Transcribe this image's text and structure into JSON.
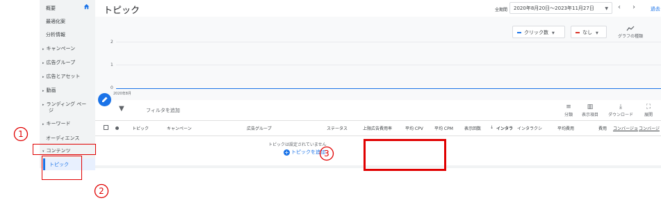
{
  "sidebar": {
    "items": [
      {
        "label": "概要",
        "expandable": false
      },
      {
        "label": "最適化案",
        "expandable": false
      },
      {
        "label": "分析情報",
        "expandable": false
      },
      {
        "label": "キャンペーン",
        "expandable": true
      },
      {
        "label": "広告グループ",
        "expandable": true
      },
      {
        "label": "広告とアセット",
        "expandable": true
      },
      {
        "label": "動画",
        "expandable": true
      },
      {
        "label": "ランディング ペー",
        "label2": "ジ",
        "expandable": true
      },
      {
        "label": "キーワード",
        "expandable": true
      },
      {
        "label": "オーディエンス",
        "expandable": false
      },
      {
        "label": "コンテンツ",
        "expandable": true,
        "expanded": true
      },
      {
        "label": "トピック",
        "active": true
      }
    ]
  },
  "header": {
    "title": "トピック",
    "period_label": "全期間",
    "date_range": "2020年8月20日～2023年11月27日",
    "nav_link": "過去"
  },
  "chart_controls": {
    "metric1": "クリック数",
    "metric1_color": "#1a73e8",
    "metric2": "なし",
    "metric2_color": "#d93025",
    "graph_type": "グラフの種類"
  },
  "chart_data": {
    "type": "line",
    "x": [
      "2020年8月"
    ],
    "series": [
      {
        "values": [
          0
        ]
      }
    ],
    "yticks": [
      "2",
      "1",
      "0"
    ],
    "ylim": [
      0,
      2
    ],
    "grid": true
  },
  "toolbar": {
    "filter_placeholder": "フィルタを追加",
    "segment": "分類",
    "columns": "表示項目",
    "download": "ダウンロード",
    "expand": "展開"
  },
  "table": {
    "columns": [
      "トピック",
      "キャンペーン",
      "広告グループ",
      "ステータス",
      "上限広告費用率",
      "平均 CPV",
      "平均 CPM",
      "表示回数",
      "インタラ",
      "インタラクシ",
      "平均費用",
      "費用",
      "コンバージョ",
      "コンバージ"
    ],
    "sort_indicator": "↓",
    "empty_message": "トピックは設定されていません",
    "add_button": "トピックを追加"
  },
  "annotations": {
    "marker1": "①",
    "marker2": "②",
    "marker3": "③",
    "color": "#e00000"
  }
}
